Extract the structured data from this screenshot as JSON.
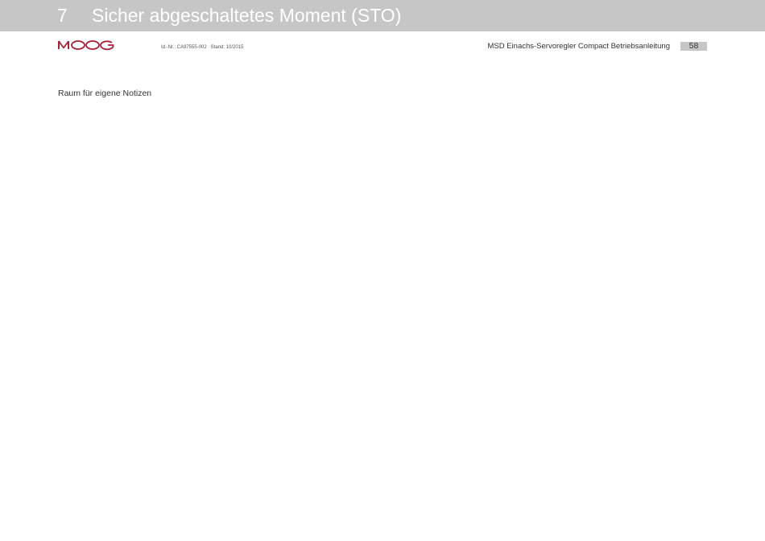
{
  "header": {
    "chapter_number": "7",
    "chapter_title": "Sicher abgeschaltetes Moment (STO)"
  },
  "branding": {
    "logo_icon": "moog-logo-icon",
    "brand_color": "#a8203a"
  },
  "meta": {
    "id_number": "Id.-Nr.: CA97555-002",
    "status": "Stand: 10/2015",
    "manual_title": "MSD Einachs-Servoregler Compact Betriebsanleitung",
    "page_number": "58"
  },
  "content": {
    "notes_label": "Raum für eigene Notizen"
  },
  "colors": {
    "header_bar": "#c6c6c6",
    "header_text": "#ffffff",
    "body_text": "#333333"
  }
}
